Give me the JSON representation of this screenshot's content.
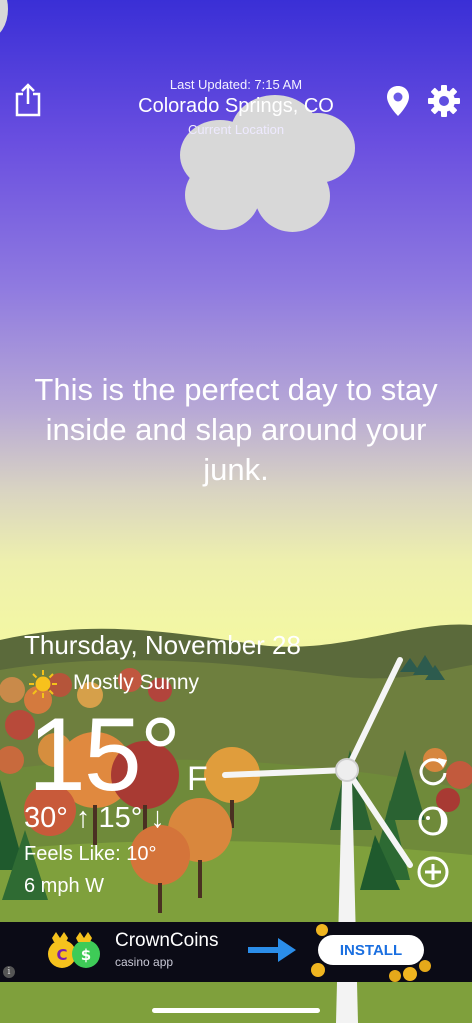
{
  "header": {
    "last_updated": "Last Updated: 7:15 AM",
    "city": "Colorado Springs, CO",
    "location_label": "Current Location"
  },
  "icons": {
    "share": "share-icon",
    "location": "location-pin-icon",
    "settings": "gear-icon",
    "refresh": "refresh-icon",
    "moon": "moon-phase-icon",
    "add": "add-location-icon",
    "sun": "sun-icon"
  },
  "message": "This is the perfect day to stay inside and slap around your junk.",
  "weather": {
    "date": "Thursday, November 28",
    "condition": "Mostly Sunny",
    "temperature": "15°",
    "unit": "F",
    "high_low": "30° ↑ 15° ↓",
    "feels_like": "Feels Like: 10°",
    "wind": "6 mph W"
  },
  "ad": {
    "title": "CrownCoins",
    "subtitle": "casino app",
    "button": "INSTALL"
  },
  "colors": {
    "sky_top": "#3a2fd6",
    "sky_bottom": "#f0f59f",
    "ad_bg": "#0b0b16",
    "install_text": "#1a6fe0"
  }
}
